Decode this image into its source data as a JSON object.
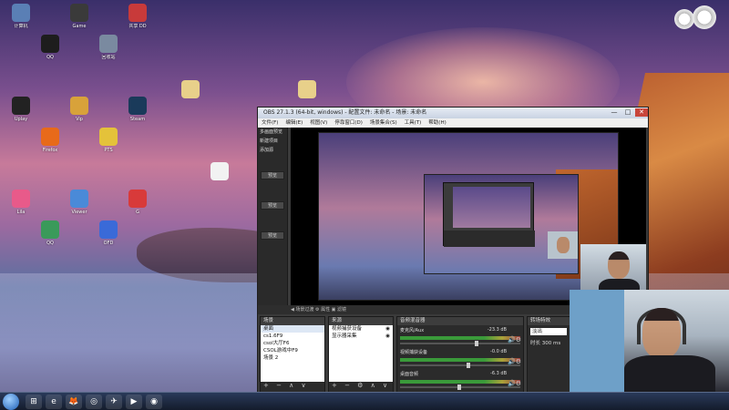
{
  "desktop": {
    "icons": [
      {
        "label": "计算机",
        "color": "#5a7fb5"
      },
      {
        "label": "QQ",
        "color": "#1d1d1d"
      },
      {
        "label": "Game",
        "color": "#3a3a3a"
      },
      {
        "label": "回收站",
        "color": "#7a8aa0"
      },
      {
        "label": "共享 DD",
        "color": "#c83a3a"
      },
      {
        "label": "Uplay",
        "color": "#222"
      },
      {
        "label": "Firefox",
        "color": "#e86a1a"
      },
      {
        "label": "Vip",
        "color": "#d8a23a"
      },
      {
        "label": "PTS",
        "color": "#e4c23a"
      },
      {
        "label": "Steam",
        "color": "#1a3a5a"
      },
      {
        "label": "Lila",
        "color": "#e85a8a"
      },
      {
        "label": "QQ",
        "color": "#3a9a5a"
      },
      {
        "label": "Viewer",
        "color": "#4a8ad8"
      },
      {
        "label": "OFD",
        "color": "#3a6ad8"
      },
      {
        "label": "G",
        "color": "#d83a3a"
      }
    ],
    "taskbar": {
      "buttons": [
        "⊞",
        "e",
        "🦊",
        "◎",
        "✈",
        "▶",
        "◉"
      ]
    }
  },
  "obs": {
    "title": "OBS 27.1.3 (64-bit, windows) - 配置文件: 未命名 - 场景: 未命名",
    "title_controls": [
      "—",
      "□",
      "✕"
    ],
    "menu": [
      "文件(F)",
      "编辑(E)",
      "视图(V)",
      "停靠窗口(D)",
      "场景集合(S)",
      "工具(T)",
      "帮助(H)"
    ],
    "left_panel": {
      "items": [
        "多画面预览",
        "新建项目",
        "添加源"
      ],
      "buttons": [
        "预览",
        "预览",
        "预览"
      ]
    },
    "bottom_bar": "◀ 场景过渡   ⚙ 属性   ▣ 滤镜",
    "scenes": {
      "header": "场景",
      "items": [
        "桌面",
        "cs1.6F9",
        "csol大厅F6",
        "CSOL游戏中F9",
        "场景 2"
      ],
      "selected": 0,
      "footer": "+ − ∧ ∨"
    },
    "sources": {
      "header": "来源",
      "items": [
        "视频捕获设备",
        "显示器采集"
      ],
      "footer": "+ − ⚙ ∧ ∨"
    },
    "mixer": {
      "header": "音频混音器",
      "channels": [
        {
          "name": "麦克风/Aux",
          "db": "-23.3 dB",
          "level": 0.62
        },
        {
          "name": "视频捕获设备",
          "db": "-0.0 dB",
          "level": 0.55
        },
        {
          "name": "桌面音频",
          "db": "-6.3 dB",
          "level": 0.48
        }
      ]
    },
    "transitions": {
      "header": "转场特效",
      "selected": "淡出",
      "duration_label": "时长",
      "duration_value": "300 ms"
    }
  },
  "colors": {
    "obs_bg": "#3b3b3b",
    "meter_green": "#3a9a3a"
  }
}
